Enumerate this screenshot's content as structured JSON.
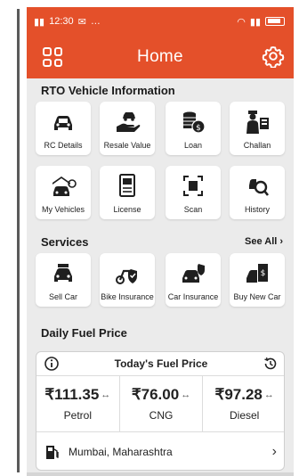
{
  "status": {
    "time": "12:30",
    "carrier": "…"
  },
  "header": {
    "title": "Home"
  },
  "rto": {
    "title": "RTO Vehicle Information",
    "items": [
      {
        "label": "RC Details",
        "icon": "car-icon"
      },
      {
        "label": "Resale Value",
        "icon": "hand-car-icon"
      },
      {
        "label": "Loan",
        "icon": "coins-icon"
      },
      {
        "label": "Challan",
        "icon": "police-icon"
      },
      {
        "label": "My Vehicles",
        "icon": "car-home-icon"
      },
      {
        "label": "License",
        "icon": "license-icon"
      },
      {
        "label": "Scan",
        "icon": "scan-icon"
      },
      {
        "label": "History",
        "icon": "history-search-icon"
      }
    ]
  },
  "services": {
    "title": "Services",
    "see_all": "See All",
    "items": [
      {
        "label": "Sell Car",
        "icon": "sell-car-icon"
      },
      {
        "label": "Bike Insurance",
        "icon": "bike-shield-icon"
      },
      {
        "label": "Car Insurance",
        "icon": "car-shield-icon"
      },
      {
        "label": "Buy New Car",
        "icon": "buy-car-icon"
      }
    ]
  },
  "fuel": {
    "section_title": "Daily Fuel Price",
    "card_title": "Today's Fuel Price",
    "prices": [
      {
        "value": "₹111.35",
        "name": "Petrol"
      },
      {
        "value": "₹76.00",
        "name": "CNG"
      },
      {
        "value": "₹97.28",
        "name": "Diesel"
      }
    ],
    "location": "Mumbai, Maharashtra"
  },
  "colors": {
    "accent": "#e4502a",
    "background": "#ebebeb"
  }
}
